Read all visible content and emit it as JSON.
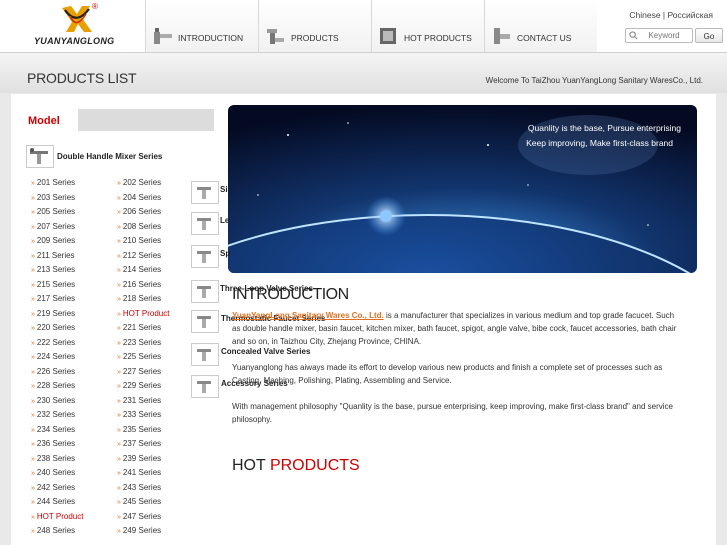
{
  "header": {
    "logo_text": "YUANYANGLONG",
    "logo_reg": "®",
    "nav": [
      {
        "label": "INTRODUCTION",
        "icon": "faucet-icon"
      },
      {
        "label": "PRODUCTS",
        "icon": "mixer-icon"
      },
      {
        "label": "HOT PRODUCTS",
        "icon": "hot-product-icon"
      },
      {
        "label": "CONTACT US",
        "icon": "contact-icon"
      }
    ],
    "lang": "Chinese | Российская",
    "search_placeholder": "Keyword",
    "go_label": "Go"
  },
  "title_bar": {
    "title": "PRODUCTS LIST",
    "welcome": "Welcome To TaiZhou YuanYangLong Sanitary WaresCo., Ltd."
  },
  "sidebar": {
    "model_title": "Model",
    "main_category": "Double Handle Mixer Series",
    "col1": [
      "201 Series",
      "203 Series",
      "205 Series",
      "207 Series",
      "209 Series",
      "211 Series",
      "213 Series",
      "215 Series",
      "217 Series",
      "219 Series",
      "220 Series",
      "222 Series",
      "224 Series",
      "226 Series",
      "228 Series",
      "230 Series",
      "232 Series",
      "234 Series",
      "236 Series",
      "238 Series",
      "240 Series",
      "242 Series",
      "244 Series",
      "HOT Product",
      "248 Series"
    ],
    "col2": [
      "202 Series",
      "204 Series",
      "206 Series",
      "208 Series",
      "210 Series",
      "212 Series",
      "214 Series",
      "216 Series",
      "218 Series",
      "HOT Product",
      "221 Series",
      "223 Series",
      "225 Series",
      "227 Series",
      "229 Series",
      "231 Series",
      "233 Series",
      "235 Series",
      "237 Series",
      "239 Series",
      "241 Series",
      "243 Series",
      "245 Series",
      "247 Series",
      "249 Series"
    ],
    "other_categories": [
      "Si",
      "Le",
      "Sp",
      "Three-Loop Valve Series",
      "Thermostatic Faucet Series",
      "Concealed Valve Series",
      "Accessory Series"
    ]
  },
  "hero": {
    "line1": "Quanlity is the base, Pursue enterprising",
    "line2": "Keep improving, Make first-class brand"
  },
  "intro": {
    "heading": "INTRODUCTION",
    "company": "YuanYangLong Sanitary Wares Co., Ltd.",
    "p1_rest": " is a manufacturer that specializes in various medium and top grade facucet. Such",
    "p1_line2": "as double handle mixer, basin faucet, kitchen mixer, bath faucet, spigot, angle valve, bibe cock, faucet accessories, bath chair",
    "p1_line3": "and so on, in Taizhou City, Zhejang Province, CHINA.",
    "p2_line1": "Yuanyanglong has aiways made its effort to develop various new products and finish a complete set of processes such as",
    "p2_line2": "Casting, Maching, Polishing, Plating, Assembling and Service.",
    "p3_line1": "With management philosophy \"Quanlity is the base, pursue enterprising, keep improving, make first-class brand\" and service",
    "p3_line2": "philosophy."
  },
  "hot": {
    "word1": "HOT",
    "word2": "PRODUCTS"
  },
  "colors": {
    "accent_red": "#cc0000",
    "arrow_orange": "#e07020"
  }
}
